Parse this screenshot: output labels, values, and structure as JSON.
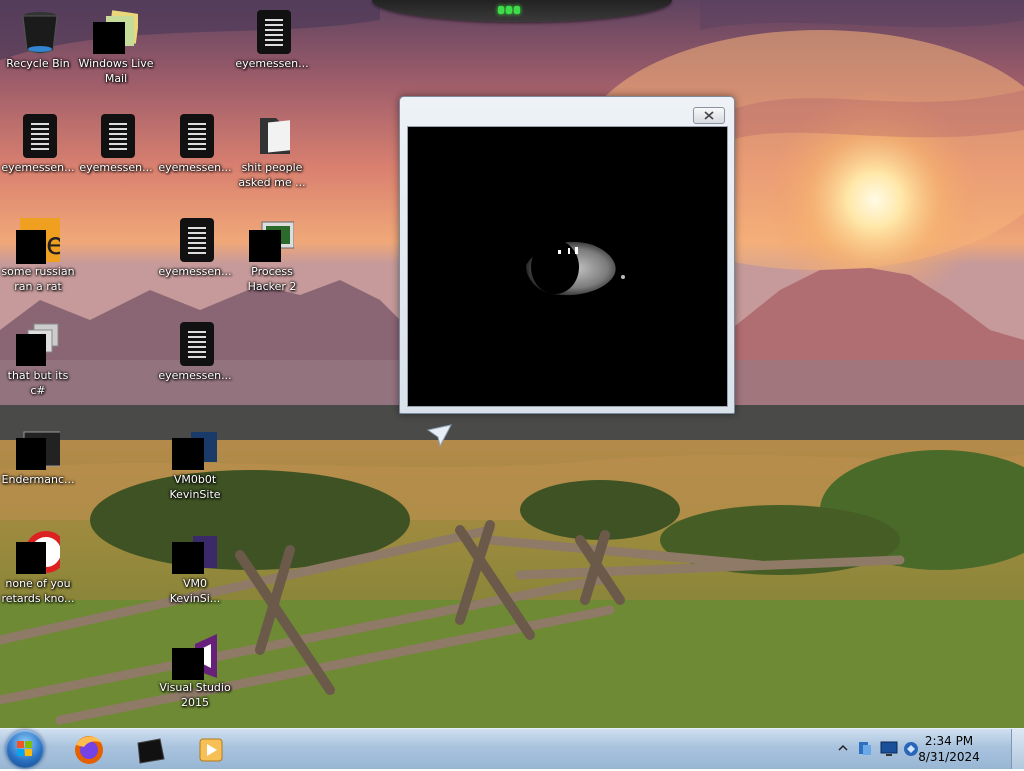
{
  "desktop": {
    "icons": [
      {
        "label": "Recycle Bin",
        "icon": "recycle-bin-icon"
      },
      {
        "label": "Windows Live\nMail",
        "icon": "mail-icon"
      },
      {
        "label": "eyemessen...",
        "icon": "text-file-icon"
      },
      {
        "label": "eyemessen...",
        "icon": "text-file-icon"
      },
      {
        "label": "eyemessen...",
        "icon": "text-file-icon"
      },
      {
        "label": "eyemessen...",
        "icon": "text-file-icon"
      },
      {
        "label": "shit people\nasked me ...",
        "icon": "folder-icon"
      },
      {
        "label": "some russian\nran a rat",
        "icon": "exe-icon"
      },
      {
        "label": "eyemessen...",
        "icon": "text-file-icon"
      },
      {
        "label": "Process\nHacker 2",
        "icon": "process-hacker-icon"
      },
      {
        "label": "that but its c#",
        "icon": "shortcut-icon"
      },
      {
        "label": "eyemessen...",
        "icon": "text-file-icon"
      },
      {
        "label": "Endermanc...",
        "icon": "app-icon"
      },
      {
        "label": "VM0b0t\nKevinSite",
        "icon": "app-icon"
      },
      {
        "label": "none of you\nretards kno...",
        "icon": "app-icon"
      },
      {
        "label": "VM0\nKevinSi...",
        "icon": "app-icon"
      },
      {
        "label": "Visual Studio\n2015",
        "icon": "visual-studio-icon"
      }
    ]
  },
  "popup_window": {
    "close_icon": "close-icon",
    "content": "eye-image"
  },
  "taskbar": {
    "start": "windows-start-orb",
    "pinned": [
      "firefox-icon",
      "tablet-app-icon",
      "media-player-icon"
    ],
    "tray_icons": [
      "show-hidden-icons-chevron",
      "network-icon",
      "display-icon",
      "connection-icon"
    ],
    "clock_time": "2:34 PM",
    "clock_date": "8/31/2024"
  },
  "colors": {
    "taskbar": "#a9c3de",
    "sky_top": "#6f4a62",
    "sun": "#fff3c8"
  }
}
